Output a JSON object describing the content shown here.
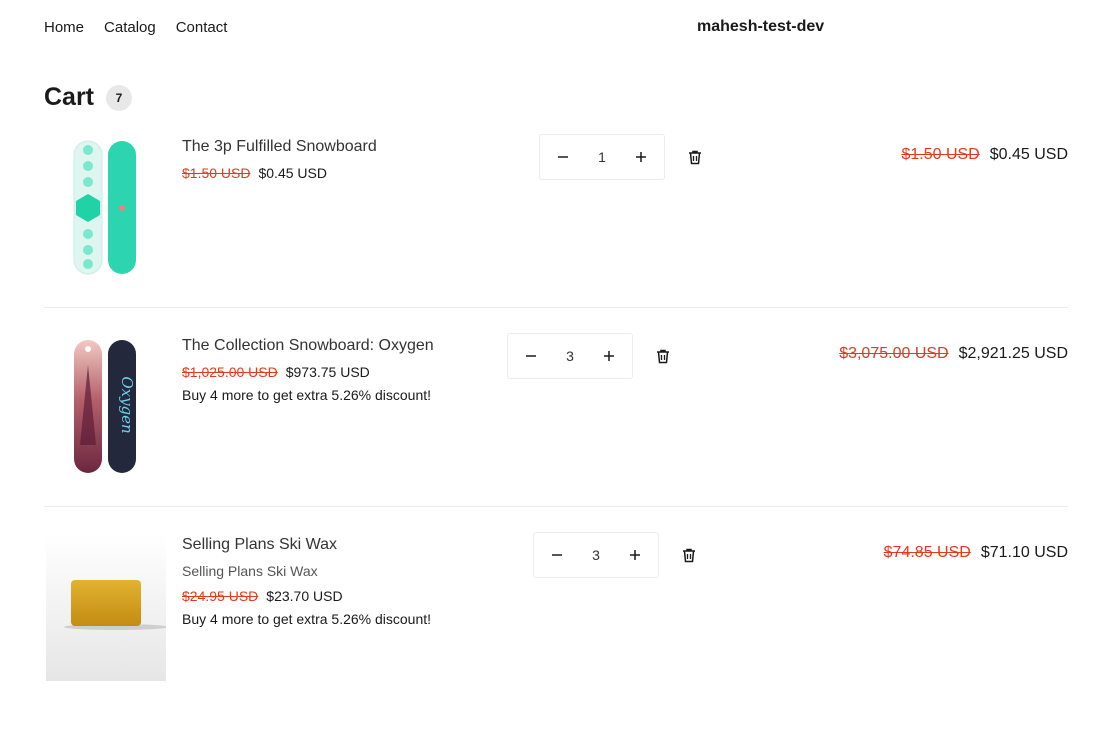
{
  "header": {
    "nav": [
      "Home",
      "Catalog",
      "Contact"
    ],
    "store_name": "mahesh-test-dev"
  },
  "cart": {
    "title": "Cart",
    "count": "7",
    "items": [
      {
        "name": "The 3p Fulfilled Snowboard",
        "variant": "",
        "compare_price": "$1.50 USD",
        "price": "$0.45 USD",
        "promo": "",
        "quantity": "1",
        "line_compare": "$1.50 USD",
        "line_total": "$0.45 USD"
      },
      {
        "name": "The Collection Snowboard: Oxygen",
        "variant": "",
        "compare_price": "$1,025.00 USD",
        "price": "$973.75 USD",
        "promo": "Buy 4 more to get extra 5.26% discount!",
        "quantity": "3",
        "line_compare": "$3,075.00 USD",
        "line_total": "$2,921.25 USD"
      },
      {
        "name": "Selling Plans Ski Wax",
        "variant": "Selling Plans Ski Wax",
        "compare_price": "$24.95 USD",
        "price": "$23.70 USD",
        "promo": "Buy 4 more to get extra 5.26% discount!",
        "quantity": "3",
        "line_compare": "$74.85 USD",
        "line_total": "$71.10 USD"
      }
    ]
  },
  "colors": {
    "compare_price": "#e23b1c",
    "text": "#1a1a1a",
    "divider": "#ececec"
  },
  "icons": [
    "minus-icon",
    "plus-icon",
    "trash-icon"
  ]
}
